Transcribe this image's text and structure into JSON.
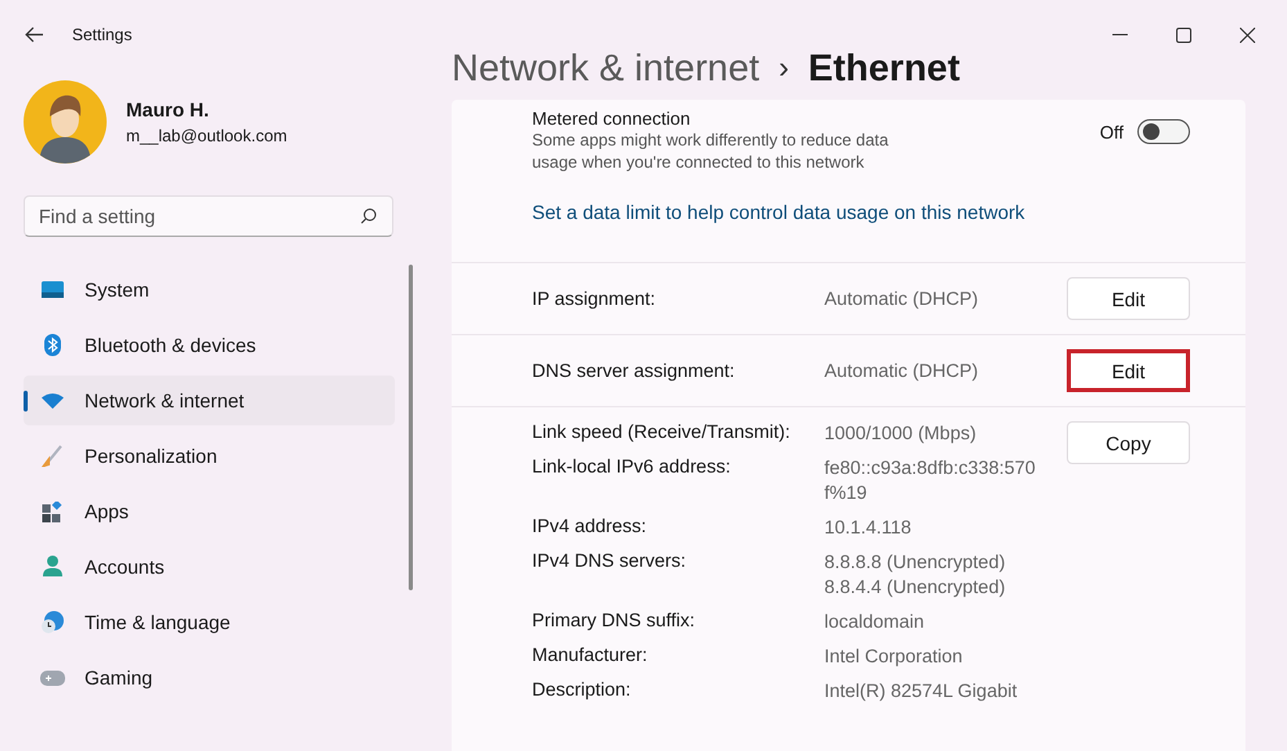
{
  "window": {
    "title": "Settings"
  },
  "user": {
    "name": "Mauro H.",
    "email": "m__lab@outlook.com"
  },
  "search": {
    "placeholder": "Find a setting"
  },
  "sidebar": {
    "items": [
      {
        "label": "System",
        "selected": false
      },
      {
        "label": "Bluetooth & devices",
        "selected": false
      },
      {
        "label": "Network & internet",
        "selected": true
      },
      {
        "label": "Personalization",
        "selected": false
      },
      {
        "label": "Apps",
        "selected": false
      },
      {
        "label": "Accounts",
        "selected": false
      },
      {
        "label": "Time & language",
        "selected": false
      },
      {
        "label": "Gaming",
        "selected": false
      }
    ]
  },
  "breadcrumb": {
    "parent": "Network & internet",
    "separator": "›",
    "current": "Ethernet"
  },
  "metered": {
    "title": "Metered connection",
    "description": "Some apps might work differently to reduce data usage when you're connected to this network",
    "state_label": "Off",
    "on": false
  },
  "data_limit_link": "Set a data limit to help control data usage on this network",
  "assignments": [
    {
      "label": "IP assignment:",
      "value": "Automatic (DHCP)",
      "button": "Edit",
      "highlighted": false
    },
    {
      "label": "DNS server assignment:",
      "value": "Automatic (DHCP)",
      "button": "Edit",
      "highlighted": true
    }
  ],
  "properties": [
    {
      "label": "Link speed (Receive/Transmit):",
      "values": [
        "1000/1000 (Mbps)"
      ]
    },
    {
      "label": "Link-local IPv6 address:",
      "values": [
        "fe80::c93a:8dfb:c338:570f%19"
      ]
    },
    {
      "label": "IPv4 address:",
      "values": [
        "10.1.4.118"
      ]
    },
    {
      "label": "IPv4 DNS servers:",
      "values": [
        "8.8.8.8 (Unencrypted)",
        "8.8.4.4 (Unencrypted)"
      ]
    },
    {
      "label": "Primary DNS suffix:",
      "values": [
        "localdomain"
      ]
    },
    {
      "label": "Manufacturer:",
      "values": [
        "Intel Corporation"
      ]
    },
    {
      "label": "Description:",
      "values": [
        "Intel(R) 82574L Gigabit"
      ]
    }
  ],
  "copy_button": "Copy"
}
